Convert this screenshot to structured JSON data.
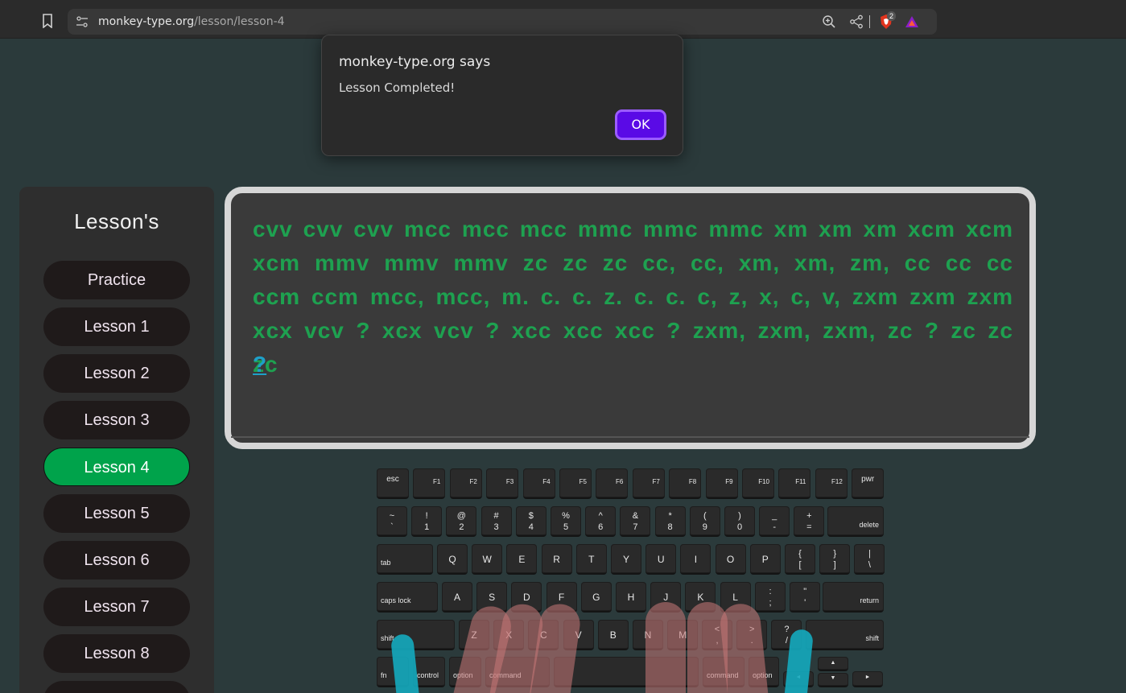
{
  "browser": {
    "url_host": "monkey-type.org",
    "url_path": "/lesson/lesson-4",
    "shield_count": "2"
  },
  "dialog": {
    "title": "monkey-type.org says",
    "message": "Lesson Completed!",
    "ok_label": "OK"
  },
  "sidebar": {
    "title": "Lesson's",
    "items": [
      {
        "label": "Practice"
      },
      {
        "label": "Lesson 1"
      },
      {
        "label": "Lesson 2"
      },
      {
        "label": "Lesson 3"
      },
      {
        "label": "Lesson 4"
      },
      {
        "label": "Lesson 5"
      },
      {
        "label": "Lesson 6"
      },
      {
        "label": "Lesson 7"
      },
      {
        "label": "Lesson 8"
      }
    ],
    "active": "Lesson 4"
  },
  "typing": {
    "lines": [
      "cvv cvv cvv mcc mcc mcc mmc mmc mmc xm xm xm xcm xcm",
      "xcm mmv mmv mmv zc zc zc cc, cc, xm, xm, zm, cc cc cc ccm",
      "ccm ccm mcc, mcc, m. c. c. z. c. c. c, z, x, c, v, zxm zxm zxm",
      "xcx vcv ? xcx vcv ? xcc xcc xcc ? zxm, zxm, zxm, zc ? zc zc zc"
    ],
    "current": "?",
    "typed_color": "#1ea150",
    "current_color": "#1ea0c8"
  },
  "keyboard": {
    "fn_row": [
      "esc",
      "F1",
      "F2",
      "F3",
      "F4",
      "F5",
      "F6",
      "F7",
      "F8",
      "F9",
      "F10",
      "F11",
      "F12",
      "pwr"
    ],
    "num_row": [
      [
        "~",
        "`"
      ],
      [
        "!",
        "1"
      ],
      [
        "@",
        "2"
      ],
      [
        "#",
        "3"
      ],
      [
        "$",
        "4"
      ],
      [
        "%",
        "5"
      ],
      [
        "^",
        "6"
      ],
      [
        "&",
        "7"
      ],
      [
        "*",
        "8"
      ],
      [
        "(",
        "9"
      ],
      [
        ")",
        "0"
      ],
      [
        "_",
        "-"
      ],
      [
        "+",
        "="
      ]
    ],
    "delete": "delete",
    "tab": "tab",
    "q_row": [
      "Q",
      "W",
      "E",
      "R",
      "T",
      "Y",
      "U",
      "I",
      "O",
      "P"
    ],
    "q_extra": [
      [
        "{",
        "["
      ],
      [
        "}",
        "]"
      ],
      [
        "|",
        "\\"
      ]
    ],
    "caps": "caps lock",
    "a_row": [
      "A",
      "S",
      "D",
      "F",
      "G",
      "H",
      "J",
      "K",
      "L"
    ],
    "a_extra": [
      [
        ":",
        ";"
      ],
      [
        "\"",
        "'"
      ]
    ],
    "return": "return",
    "shift_l": "shift",
    "z_row": [
      "Z",
      "X",
      "C",
      "V",
      "B",
      "N",
      "M"
    ],
    "z_extra": [
      [
        "<",
        ","
      ],
      [
        ">",
        "."
      ],
      [
        "?",
        "/"
      ]
    ],
    "shift_r": "shift",
    "bottom": {
      "fn": "fn",
      "control": "control",
      "option_l": "option",
      "command_l": "command",
      "command_r": "command",
      "option_r": "option"
    },
    "arrows": {
      "up": "▲",
      "down": "▼",
      "left": "◄",
      "right": "►"
    }
  }
}
